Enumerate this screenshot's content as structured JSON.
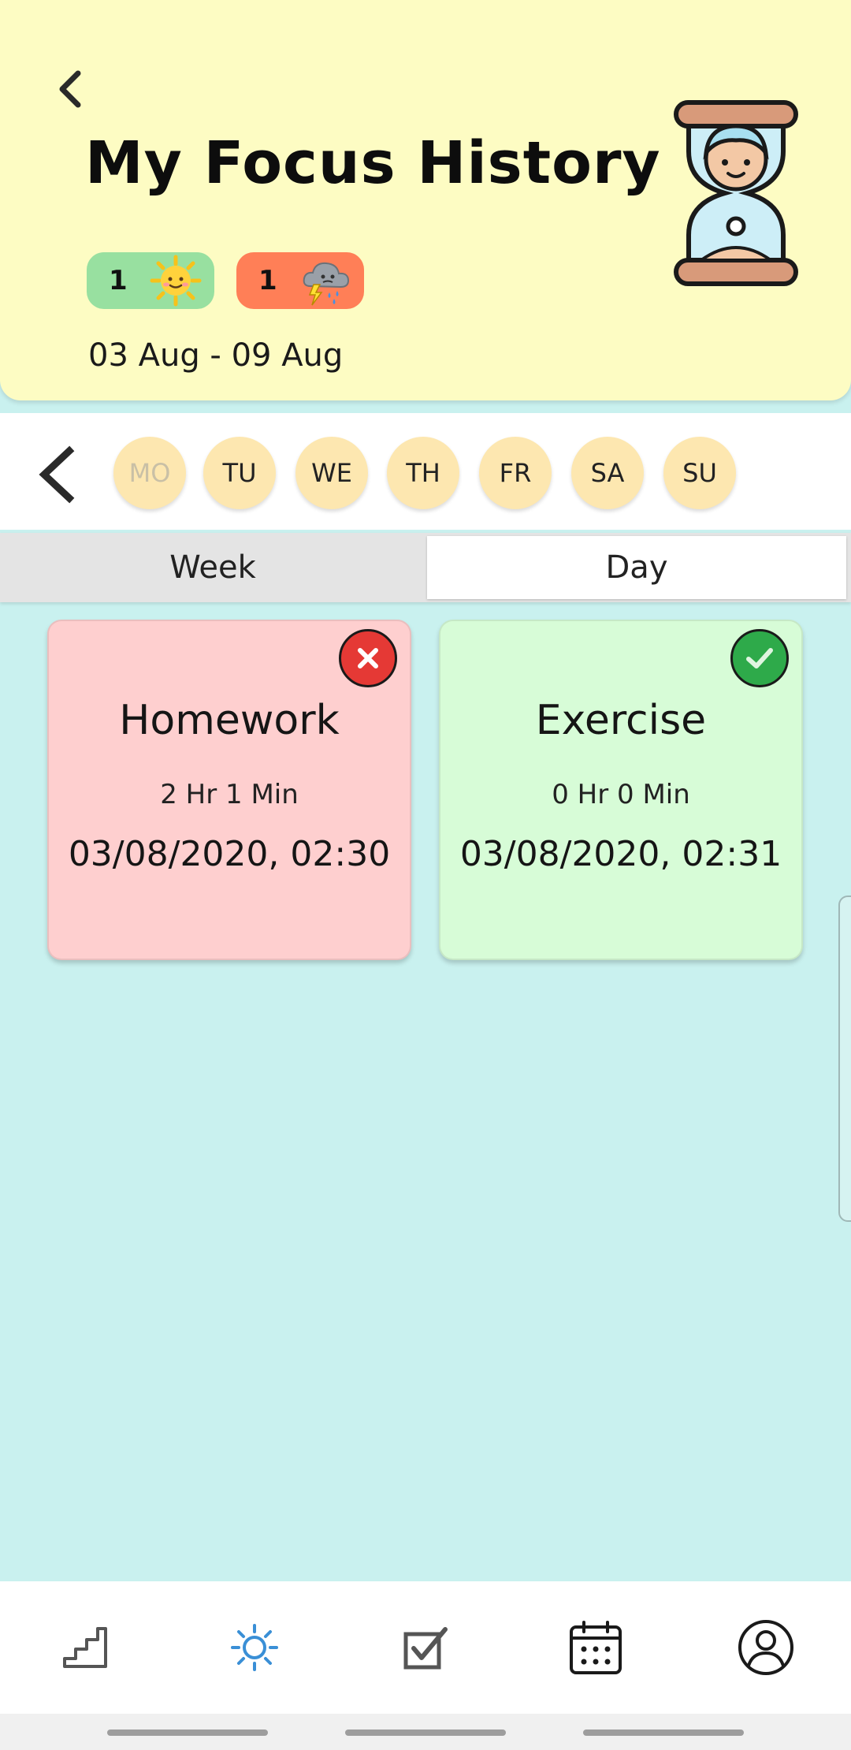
{
  "header": {
    "title": "My Focus History",
    "date_range": "03 Aug - 09 Aug",
    "badges": [
      {
        "count": "1",
        "icon": "sun-icon",
        "color": "#98e0a0"
      },
      {
        "count": "1",
        "icon": "storm-cloud-icon",
        "color": "#ff7f57"
      }
    ]
  },
  "days": [
    {
      "label": "MO",
      "active": false
    },
    {
      "label": "TU",
      "active": true
    },
    {
      "label": "WE",
      "active": true
    },
    {
      "label": "TH",
      "active": true
    },
    {
      "label": "FR",
      "active": true
    },
    {
      "label": "SA",
      "active": true
    },
    {
      "label": "SU",
      "active": true
    }
  ],
  "tabs": {
    "week": "Week",
    "day": "Day",
    "selected": "Day"
  },
  "sessions": [
    {
      "title": "Homework",
      "duration": "2 Hr 1 Min",
      "datetime": "03/08/2020, 02:30",
      "status": "failed",
      "color": "#fecfcf"
    },
    {
      "title": "Exercise",
      "duration": "0 Hr 0 Min",
      "datetime": "03/08/2020, 02:31",
      "status": "completed",
      "color": "#d7fcd7"
    }
  ],
  "bottom_nav": [
    {
      "icon": "stairs-icon",
      "active": false
    },
    {
      "icon": "sun-outline-icon",
      "active": true
    },
    {
      "icon": "checkbox-icon",
      "active": false
    },
    {
      "icon": "calendar-icon",
      "active": false
    },
    {
      "icon": "profile-icon",
      "active": false
    }
  ],
  "colors": {
    "header_bg": "#fdfcc3",
    "page_bg": "#c9f1ef",
    "day_circle": "#fde7b0",
    "active_nav": "#3a8fd6"
  }
}
